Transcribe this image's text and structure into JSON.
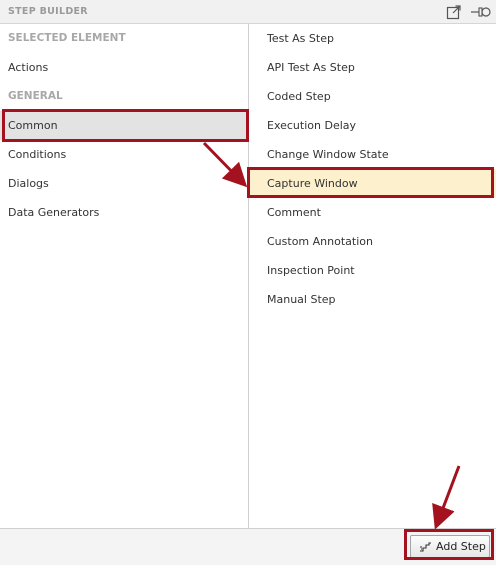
{
  "panel": {
    "title": "STEP BUILDER"
  },
  "left": {
    "header_selected": "SELECTED ELEMENT",
    "item_actions": "Actions",
    "header_general": "GENERAL",
    "item_common": "Common",
    "item_conditions": "Conditions",
    "item_dialogs": "Dialogs",
    "item_data_generators": "Data Generators"
  },
  "right": {
    "items": [
      "Test As Step",
      "API Test As Step",
      "Coded Step",
      "Execution Delay",
      "Change Window State",
      "Capture Window",
      "Comment",
      "Custom Annotation",
      "Inspection Point",
      "Manual Step"
    ]
  },
  "footer": {
    "add_step_label": "Add Step"
  },
  "colors": {
    "highlight_box": "#a3121e",
    "selected_bg": "#e3e3e3",
    "hover_bg": "#fdf0cd"
  },
  "icons": [
    "popout-icon",
    "pin-icon",
    "steps-icon"
  ]
}
